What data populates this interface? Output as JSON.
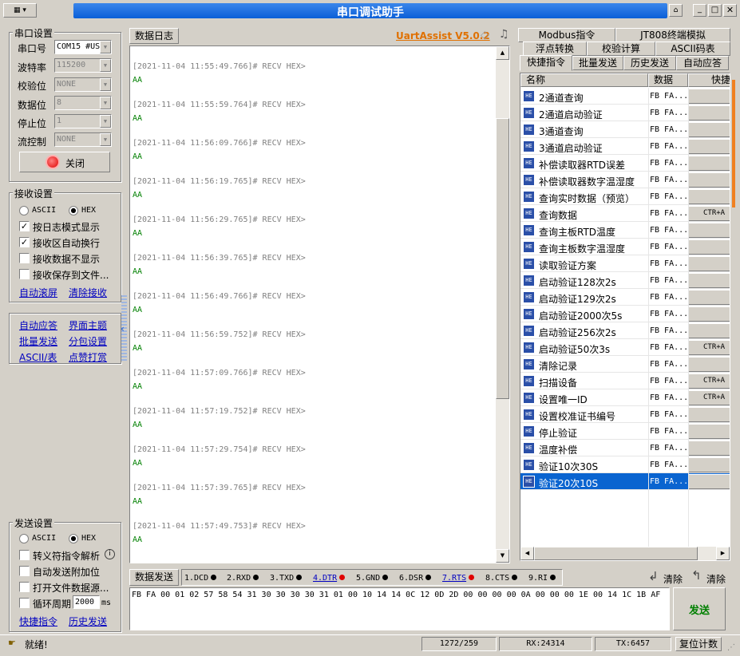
{
  "window": {
    "title": "串口调试助手"
  },
  "port": {
    "group_label": "串口设置",
    "fields": [
      {
        "label": "串口号",
        "value": "COM15 #US"
      },
      {
        "label": "波特率",
        "value": "115200"
      },
      {
        "label": "校验位",
        "value": "NONE"
      },
      {
        "label": "数据位",
        "value": "8"
      },
      {
        "label": "停止位",
        "value": "1"
      },
      {
        "label": "流控制",
        "value": "NONE"
      }
    ],
    "close_button": "关闭"
  },
  "recv": {
    "group_label": "接收设置",
    "ascii": "ASCII",
    "hex": "HEX",
    "options": [
      "按日志模式显示",
      "接收区自动换行",
      "接收数据不显示",
      "接收保存到文件..."
    ],
    "checked": [
      true,
      true,
      false,
      false
    ],
    "links": [
      "自动滚屏",
      "清除接收"
    ]
  },
  "tools": {
    "links": [
      "自动应答",
      "界面主题",
      "批量发送",
      "分包设置",
      "ASCII/表",
      "点赞打赏"
    ]
  },
  "log": {
    "tab": "数据日志",
    "brand": "UartAssist V5.0.2",
    "entries": [
      {
        "head": "[2021-11-04 11:55:49.766]# RECV HEX>",
        "data": "AA"
      },
      {
        "head": "[2021-11-04 11:55:59.764]# RECV HEX>",
        "data": "AA"
      },
      {
        "head": "[2021-11-04 11:56:09.766]# RECV HEX>",
        "data": "AA"
      },
      {
        "head": "[2021-11-04 11:56:19.765]# RECV HEX>",
        "data": "AA"
      },
      {
        "head": "[2021-11-04 11:56:29.765]# RECV HEX>",
        "data": "AA"
      },
      {
        "head": "[2021-11-04 11:56:39.765]# RECV HEX>",
        "data": "AA"
      },
      {
        "head": "[2021-11-04 11:56:49.766]# RECV HEX>",
        "data": "AA"
      },
      {
        "head": "[2021-11-04 11:56:59.752]# RECV HEX>",
        "data": "AA"
      },
      {
        "head": "[2021-11-04 11:57:09.766]# RECV HEX>",
        "data": "AA"
      },
      {
        "head": "[2021-11-04 11:57:19.752]# RECV HEX>",
        "data": "AA"
      },
      {
        "head": "[2021-11-04 11:57:29.754]# RECV HEX>",
        "data": "AA"
      },
      {
        "head": "[2021-11-04 11:57:39.765]# RECV HEX>",
        "data": "AA"
      },
      {
        "head": "[2021-11-04 11:57:49.753]# RECV HEX>",
        "data": "AA"
      }
    ]
  },
  "right_tabs": {
    "row1": [
      "Modbus指令",
      "JT808终端模拟"
    ],
    "row2": [
      "浮点转换",
      "校验计算",
      "ASCII码表"
    ],
    "row3": [
      "快捷指令",
      "批量发送",
      "历史发送",
      "自动应答"
    ]
  },
  "cmd_table": {
    "headers": [
      "名称",
      "数据",
      "快捷"
    ],
    "selected": 23,
    "rows": [
      {
        "name": "2通道查询",
        "data": "FB FA...",
        "key": ""
      },
      {
        "name": "2通道启动验证",
        "data": "FB FA...",
        "key": ""
      },
      {
        "name": "3通道查询",
        "data": "FB FA...",
        "key": ""
      },
      {
        "name": "3通道启动验证",
        "data": "FB FA...",
        "key": ""
      },
      {
        "name": "补偿读取器RTD误差",
        "data": "FB FA...",
        "key": ""
      },
      {
        "name": "补偿读取器数字温湿度",
        "data": "FB FA...",
        "key": ""
      },
      {
        "name": "查询实时数据（预览）",
        "data": "FB FA...",
        "key": ""
      },
      {
        "name": "查询数据",
        "data": "FB FA...",
        "key": "CTR+A"
      },
      {
        "name": "查询主板RTD温度",
        "data": "FB FA...",
        "key": ""
      },
      {
        "name": "查询主板数字温湿度",
        "data": "FB FA...",
        "key": ""
      },
      {
        "name": "读取验证方案",
        "data": "FB FA...",
        "key": ""
      },
      {
        "name": "启动验证128次2s",
        "data": "FB FA...",
        "key": ""
      },
      {
        "name": "启动验证129次2s",
        "data": "FB FA...",
        "key": ""
      },
      {
        "name": "启动验证2000次5s",
        "data": "FB FA...",
        "key": ""
      },
      {
        "name": "启动验证256次2s",
        "data": "FB FA...",
        "key": ""
      },
      {
        "name": "启动验证50次3s",
        "data": "FB FA...",
        "key": "CTR+A"
      },
      {
        "name": "清除记录",
        "data": "FB FA...",
        "key": ""
      },
      {
        "name": "扫描设备",
        "data": "FB FA...",
        "key": "CTR+A"
      },
      {
        "name": "设置唯一ID",
        "data": "FB FA...",
        "key": "CTR+A"
      },
      {
        "name": "设置校准证书编号",
        "data": "FB FA...",
        "key": ""
      },
      {
        "name": "停止验证",
        "data": "FB FA...",
        "key": ""
      },
      {
        "name": "温度补偿",
        "data": "FB FA...",
        "key": ""
      },
      {
        "name": "验证10次30S",
        "data": "FB FA...",
        "key": ""
      },
      {
        "name": "验证20次10S",
        "data": "FB FA...",
        "key": ""
      }
    ]
  },
  "send_settings": {
    "group_label": "发送设置",
    "ascii": "ASCII",
    "hex": "HEX",
    "options": [
      "转义符指令解析",
      "自动发送附加位",
      "打开文件数据源...",
      "循环周期"
    ],
    "period": "2000",
    "period_unit": "ms",
    "links": [
      "快捷指令",
      "历史发送"
    ]
  },
  "send_bar": {
    "tab": "数据发送",
    "signals": [
      "1.DCD",
      "2.RXD",
      "3.TXD",
      "4.DTR",
      "5.GND",
      "6.DSR",
      "7.RTS",
      "8.CTS",
      "9.RI"
    ],
    "clear1": "清除",
    "clear2": "清除",
    "payload": "FB FA 00 01 02 57 58 54 31 30 30 30 30 31 01 00 10 14 14 0C 12 0D 2D 00 00 00 00 0A 00 00 00 1E 00 14 1C 1B AF",
    "send_button": "发送"
  },
  "status": {
    "message": "就绪!",
    "counter": "1272/259",
    "rx": "RX:24314",
    "tx": "TX:6457",
    "reset": "复位计数"
  },
  "colors": {
    "title_bg": "#0a5fd8",
    "brand": "#e07000",
    "selected_row": "#0a64d0",
    "recv_text": "#008000",
    "send_text": "#008000",
    "led_red": "#e00000"
  }
}
